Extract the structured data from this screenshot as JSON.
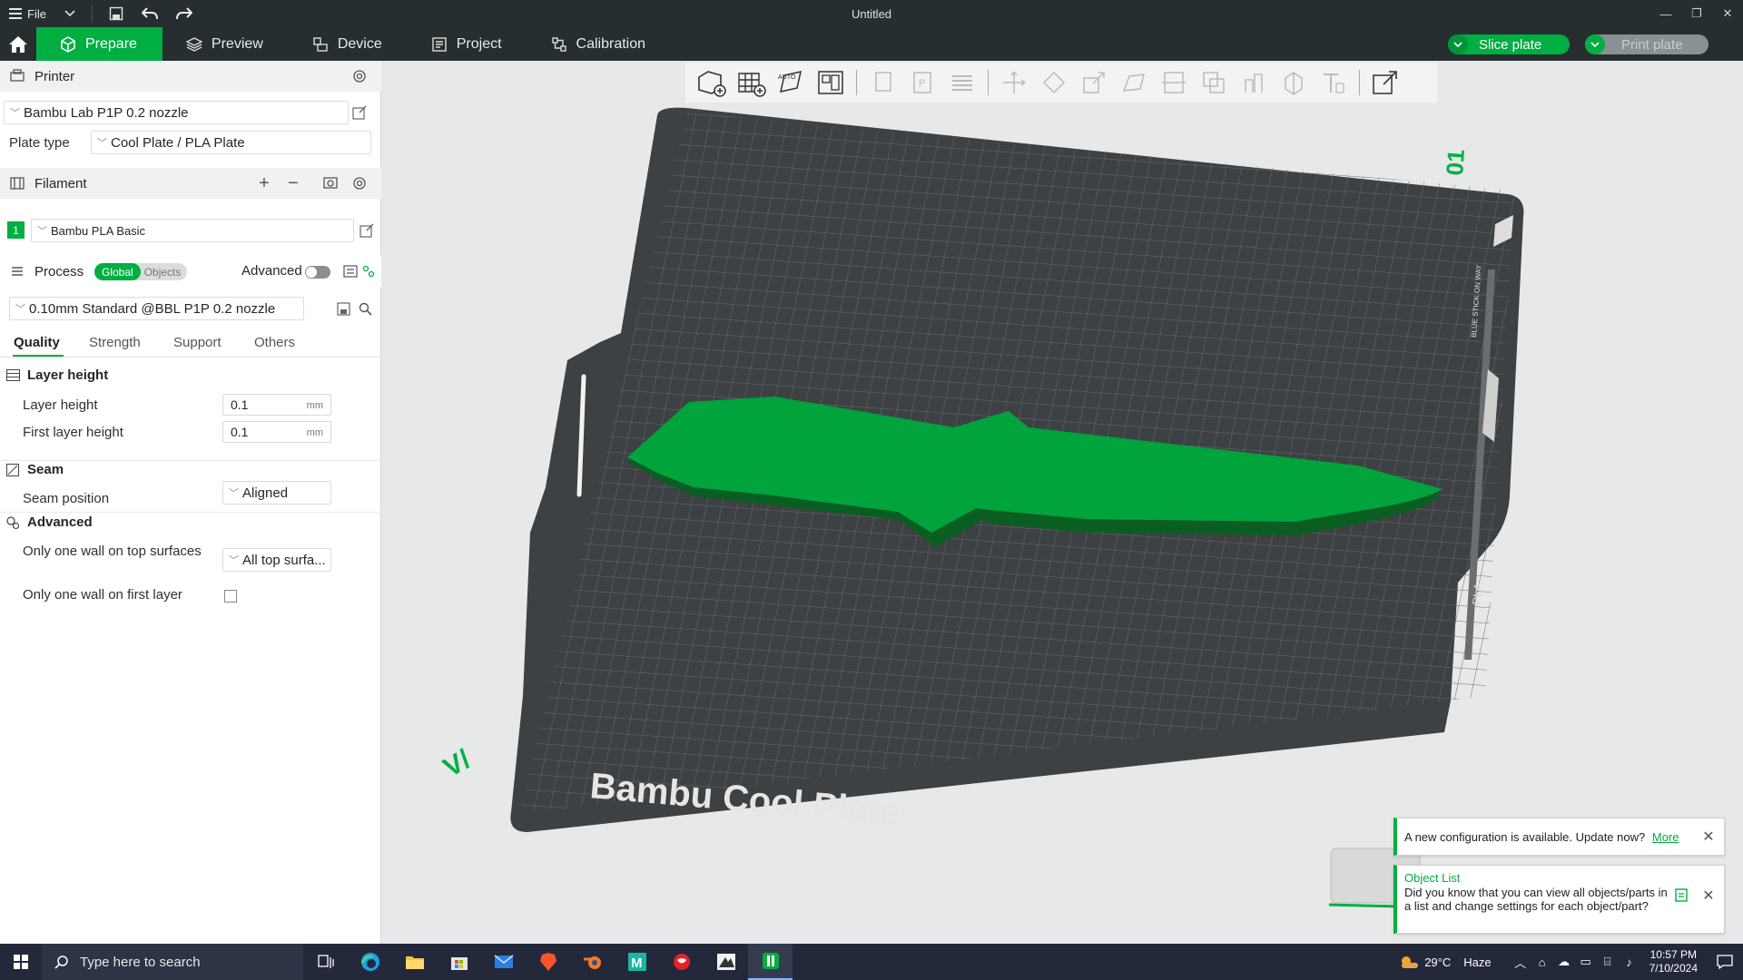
{
  "titlebar": {
    "file_label": "File",
    "title": "Untitled"
  },
  "tabs": [
    {
      "label": "Prepare"
    },
    {
      "label": "Preview"
    },
    {
      "label": "Device"
    },
    {
      "label": "Project"
    },
    {
      "label": "Calibration"
    }
  ],
  "actions": {
    "slice": "Slice plate",
    "print": "Print plate"
  },
  "printer": {
    "section": "Printer",
    "name": "Bambu Lab P1P 0.2 nozzle",
    "plate_type_label": "Plate type",
    "plate_type": "Cool Plate / PLA Plate"
  },
  "filament": {
    "section": "Filament",
    "slot": "1",
    "name": "Bambu PLA Basic",
    "slot_color": "#00ae42"
  },
  "process": {
    "section": "Process",
    "global_label": "Global",
    "objects_label": "Objects",
    "advanced_label": "Advanced",
    "advanced_on": false,
    "preset": "0.10mm Standard @BBL P1P 0.2 nozzle",
    "tabs": [
      "Quality",
      "Strength",
      "Support",
      "Others"
    ],
    "groups": {
      "layer_height": {
        "title": "Layer height",
        "layer_height_label": "Layer height",
        "layer_height": "0.1",
        "first_layer_label": "First layer height",
        "first_layer": "0.1",
        "unit": "mm"
      },
      "seam": {
        "title": "Seam",
        "position_label": "Seam position",
        "position": "Aligned"
      },
      "advanced": {
        "title": "Advanced",
        "one_wall_top_label": "Only one wall on top surfaces",
        "one_wall_top": "All top surfa...",
        "one_wall_first_label": "Only one wall on first layer",
        "one_wall_first": false
      }
    }
  },
  "plate": {
    "logo_text": "Bambu Cool Plate",
    "label_01": "01",
    "label_pla": "PLA",
    "label_sticker": "BLUE STICK ON WAY",
    "mark": "V/",
    "object_color": "#00a33c"
  },
  "notifications": {
    "update": {
      "text": "A new configuration is available. Update now?",
      "link": "More"
    },
    "tip": {
      "title": "Object List",
      "body": "Did you know that you can view all objects/parts in a list and change settings for each object/part?"
    }
  },
  "taskbar": {
    "search_placeholder": "Type here to search",
    "weather": "29°C",
    "weather_desc": "Haze",
    "time": "10:57 PM",
    "date": "7/10/2024"
  }
}
